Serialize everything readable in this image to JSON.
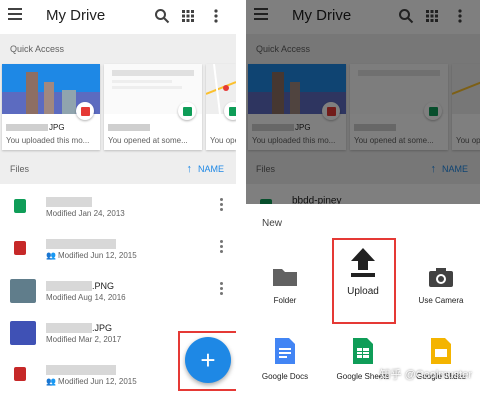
{
  "app": {
    "title": "My Drive"
  },
  "quick_access": {
    "label": "Quick Access",
    "cards": [
      {
        "file_ext": "JPG",
        "sub": "You uploaded this mo...",
        "badge_color": "#e53935"
      },
      {
        "file_ext": "",
        "sub": "You opened at some...",
        "badge_color": "#0f9d58"
      },
      {
        "file_ext": "",
        "sub": "You opened ...",
        "badge_color": "#0f9d58"
      }
    ]
  },
  "files": {
    "label": "Files",
    "sort_label": "NAME",
    "rows": [
      {
        "ext": "",
        "meta": "Modified Jan 24, 2013",
        "shared": false,
        "icon_color": "#0f9d58"
      },
      {
        "ext": "",
        "meta": "Modified Jun 12, 2015",
        "shared": true,
        "icon_color": "#c62828"
      },
      {
        "ext": ".PNG",
        "meta": "Modified Aug 14, 2016",
        "shared": false,
        "icon_color": "#607d8b"
      },
      {
        "ext": ".JPG",
        "meta": "Modified Mar 2, 2017",
        "shared": false,
        "icon_color": "#3f51b5"
      },
      {
        "ext": "",
        "meta": "Modified Jun 12, 2015",
        "shared": true,
        "icon_color": "#c62828"
      }
    ]
  },
  "right_screen": {
    "partial_file": "bbdd-piney",
    "sheet": {
      "title": "New",
      "options": [
        {
          "label": "Folder",
          "icon": "folder-icon"
        },
        {
          "label": "Upload",
          "icon": "upload-icon"
        },
        {
          "label": "Use Camera",
          "icon": "camera-icon"
        },
        {
          "label": "Google Docs",
          "icon": "docs-icon"
        },
        {
          "label": "Google Sheets",
          "icon": "sheets-icon"
        },
        {
          "label": "Google Slides",
          "icon": "slides-icon"
        }
      ]
    },
    "watermark": "知乎 @Coolmuster"
  },
  "colors": {
    "accent": "#1e88e5",
    "highlight": "#e53935"
  }
}
